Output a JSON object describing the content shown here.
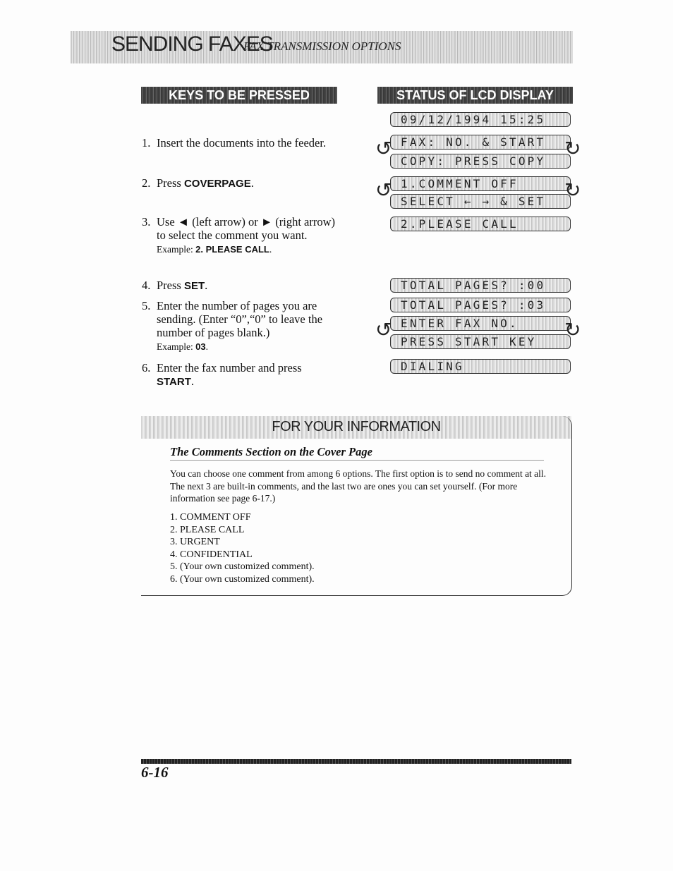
{
  "header": {
    "title": "SENDING FAXES",
    "subtitle": "FAX TRANSMISSION OPTIONS"
  },
  "columns": {
    "keys": "KEYS TO BE PRESSED",
    "lcd": "STATUS OF LCD DISPLAY"
  },
  "steps": [
    {
      "num": "1.",
      "text": "Insert the documents into the feeder."
    },
    {
      "num": "2.",
      "text": "Press ",
      "key": "COVERPAGE",
      "after": "."
    },
    {
      "num": "3.",
      "text": "Use ◄ (left arrow) or ► (right arrow) to select the comment you want.",
      "example_label": "Example: ",
      "example_value": "2. PLEASE CALL",
      "example_after": "."
    },
    {
      "num": "4.",
      "text": "Press ",
      "key": "SET",
      "after": "."
    },
    {
      "num": "5.",
      "text": "Enter the number of pages you are sending. (Enter “0”,“0” to leave the number of pages blank.)",
      "example_label": "Example: ",
      "example_value": "03",
      "example_after": "."
    },
    {
      "num": "6.",
      "text": "Enter the fax number and press",
      "key": "START",
      "after": "."
    }
  ],
  "lcd": [
    "09/12/1994 15:25",
    "FAX: NO. & START",
    "COPY: PRESS COPY",
    "1.COMMENT OFF",
    "SELECT ← → & SET",
    "2.PLEASE CALL",
    "TOTAL PAGES? :00",
    "TOTAL PAGES? :03",
    "ENTER FAX NO.",
    "PRESS START KEY",
    "DIALING"
  ],
  "info": {
    "title": "FOR YOUR INFORMATION",
    "subtitle": "The Comments Section on the Cover Page",
    "paragraph": "You can choose one comment from among 6 options. The first option is to send no comment at all. The next 3 are built-in comments, and the last two are ones you can set yourself. (For more information see page 6-17.)",
    "items": [
      "1. COMMENT OFF",
      "2. PLEASE CALL",
      "3. URGENT",
      "4. CONFIDENTIAL",
      "5. (Your own customized comment).",
      "6. (Your own customized comment)."
    ]
  },
  "footer": {
    "page_number": "6-16"
  }
}
